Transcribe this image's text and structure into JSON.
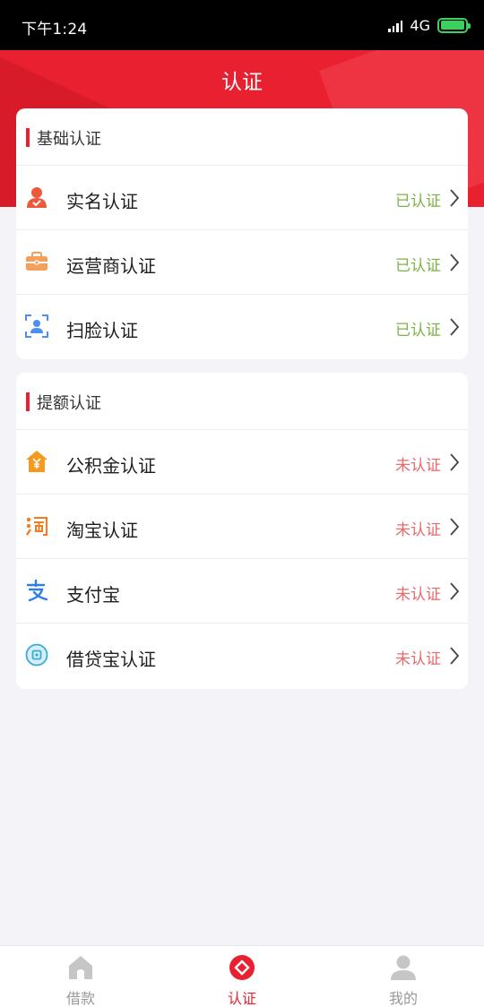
{
  "status_bar": {
    "time": "下午1:24",
    "network": "4G"
  },
  "header": {
    "title": "认证"
  },
  "sections": [
    {
      "title": "基础认证",
      "items": [
        {
          "label": "实名认证",
          "status": "已认证",
          "icon": "person-icon"
        },
        {
          "label": "运营商认证",
          "status": "已认证",
          "icon": "briefcase-icon"
        },
        {
          "label": "扫脸认证",
          "status": "已认证",
          "icon": "face-scan-icon"
        }
      ]
    },
    {
      "title": "提额认证",
      "items": [
        {
          "label": "公积金认证",
          "status": "未认证",
          "icon": "housing-fund-icon"
        },
        {
          "label": "淘宝认证",
          "status": "未认证",
          "icon": "taobao-icon"
        },
        {
          "label": "支付宝",
          "status": "未认证",
          "icon": "alipay-icon"
        },
        {
          "label": "借贷宝认证",
          "status": "未认证",
          "icon": "jiedaibao-icon"
        }
      ]
    }
  ],
  "tabs": [
    {
      "label": "借款",
      "icon": "home-icon",
      "active": false
    },
    {
      "label": "认证",
      "icon": "verify-icon",
      "active": true
    },
    {
      "label": "我的",
      "icon": "profile-icon",
      "active": false
    }
  ],
  "colors": {
    "brand": "#e8202f",
    "verified": "#7cb342",
    "unverified": "#e86a6a"
  }
}
